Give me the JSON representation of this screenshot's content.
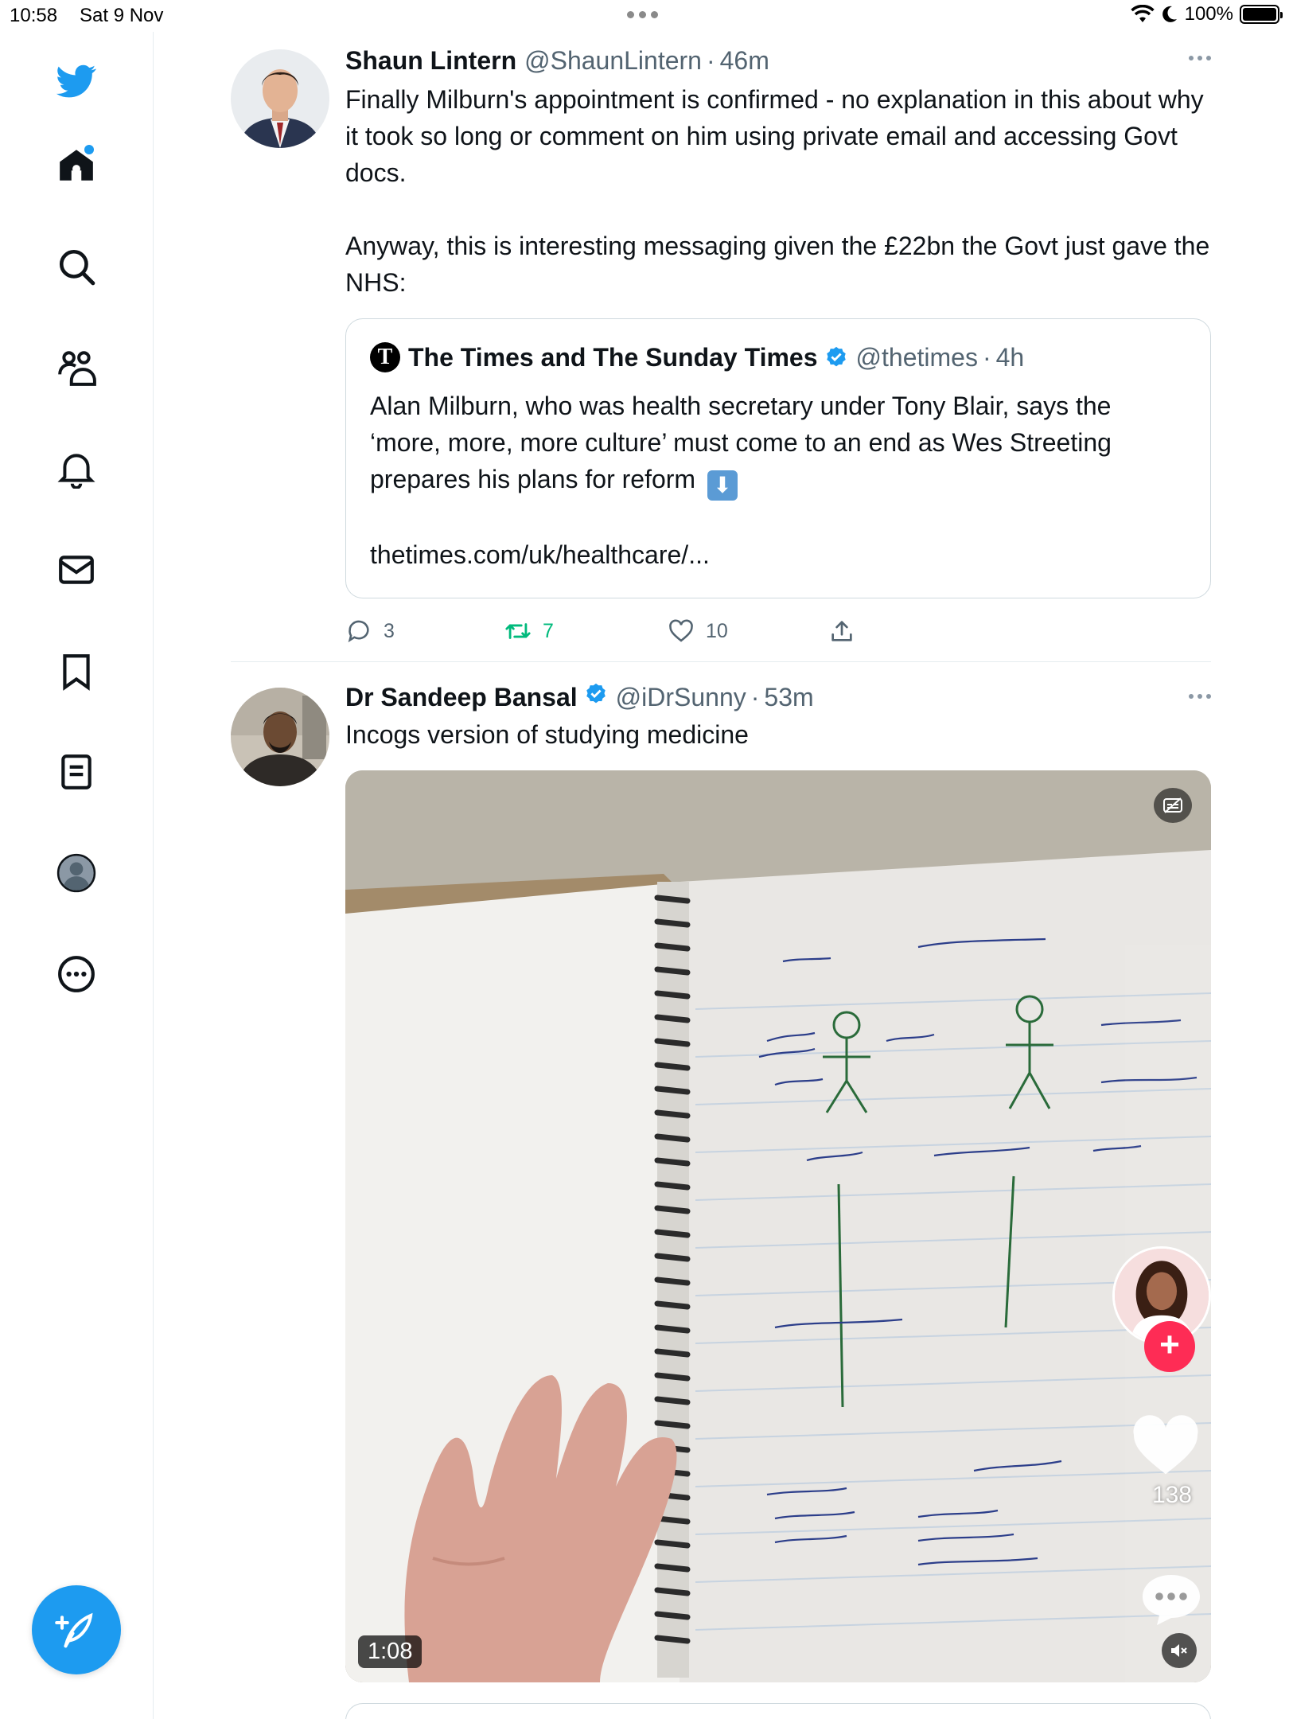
{
  "status_bar": {
    "time": "10:58",
    "date": "Sat 9 Nov",
    "battery": "100%",
    "battery_level": 1.0
  },
  "sidebar": {
    "items": [
      {
        "icon": "twitter-bird-icon",
        "label": "Twitter"
      },
      {
        "icon": "home-icon",
        "label": "Home"
      },
      {
        "icon": "search-icon",
        "label": "Explore"
      },
      {
        "icon": "communities-icon",
        "label": "Communities"
      },
      {
        "icon": "bell-icon",
        "label": "Notifications"
      },
      {
        "icon": "mail-icon",
        "label": "Messages"
      },
      {
        "icon": "bookmark-icon",
        "label": "Bookmarks"
      },
      {
        "icon": "lists-icon",
        "label": "Lists"
      },
      {
        "icon": "profile-icon",
        "label": "Profile"
      },
      {
        "icon": "more-circle-icon",
        "label": "More"
      }
    ],
    "compose_icon": "compose-feather-icon"
  },
  "colors": {
    "accent": "#1d9bf0",
    "retweet_green": "#00ba7c",
    "secondary_text": "#536471",
    "border": "#cfd9de"
  },
  "tweets": [
    {
      "name": "Shaun Lintern",
      "handle": "@ShaunLintern",
      "sep": "·",
      "time": "46m",
      "text": "Finally Milburn's appointment is confirmed - no explanation in this about why it took so long or comment on him using private email and accessing Govt docs.\n\nAnyway, this is interesting messaging given the £22bn the Govt just gave the NHS:",
      "quote": {
        "logo_letter": "T",
        "name": "The Times and The Sunday Times",
        "handle": "@thetimes",
        "sep": "·",
        "time": "4h",
        "text": "Alan Milburn, who was health secretary under Tony Blair, says the ‘more, more, more culture’ must come to an end as Wes Streeting prepares his plans for reform",
        "link": "thetimes.com/uk/healthcare/..."
      },
      "replies": "3",
      "retweets": "7",
      "likes": "10"
    },
    {
      "name": "Dr Sandeep Bansal",
      "handle": "@iDrSunny",
      "sep": "·",
      "time": "53m",
      "text": "Incogs version of studying medicine",
      "video": {
        "duration": "1:08",
        "tiktok_likes": "138"
      }
    }
  ]
}
